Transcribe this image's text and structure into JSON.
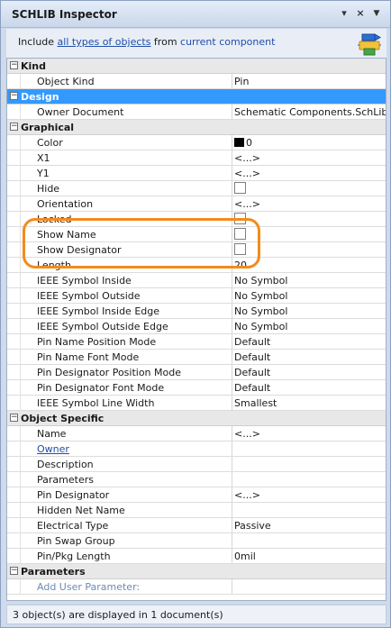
{
  "panel": {
    "title": "SCHLIB Inspector",
    "pin_glyph": "▾",
    "close_glyph": "×",
    "menu_glyph": "▼",
    "filter": {
      "prefix": "Include ",
      "link_all": "all types of objects",
      "middle": " from ",
      "link_scope": "current component"
    }
  },
  "categories": {
    "kind": {
      "label": "Kind",
      "toggle": "−"
    },
    "design": {
      "label": "Design",
      "toggle": "−"
    },
    "graphical": {
      "label": "Graphical",
      "toggle": "−"
    },
    "object_specific": {
      "label": "Object Specific",
      "toggle": "−"
    },
    "parameters": {
      "label": "Parameters",
      "toggle": "−"
    }
  },
  "kind_rows": [
    {
      "label": "Object Kind",
      "value": "Pin"
    }
  ],
  "design_rows": [
    {
      "label": "Owner Document",
      "value": "Schematic Components.SchLib"
    }
  ],
  "graphical": {
    "color": {
      "label": "Color",
      "swatch": "#000000",
      "value": "0"
    },
    "x1": {
      "label": "X1",
      "value": "<...>"
    },
    "y1": {
      "label": "Y1",
      "value": "<...>"
    },
    "hide": {
      "label": "Hide",
      "checked": false
    },
    "orientation": {
      "label": "Orientation",
      "value": "<...>"
    },
    "locked": {
      "label": "Locked",
      "checked": false
    },
    "show_name": {
      "label": "Show Name",
      "checked": false
    },
    "show_designator": {
      "label": "Show Designator",
      "checked": false
    },
    "length": {
      "label": "Length",
      "value": "20"
    },
    "text_rows": [
      {
        "label": "IEEE Symbol Inside",
        "value": "No Symbol"
      },
      {
        "label": "IEEE Symbol Outside",
        "value": "No Symbol"
      },
      {
        "label": "IEEE Symbol Inside Edge",
        "value": "No Symbol"
      },
      {
        "label": "IEEE Symbol Outside Edge",
        "value": "No Symbol"
      },
      {
        "label": "Pin Name Position Mode",
        "value": "Default"
      },
      {
        "label": "Pin Name Font Mode",
        "value": "Default"
      },
      {
        "label": "Pin Designator Position Mode",
        "value": "Default"
      },
      {
        "label": "Pin Designator Font Mode",
        "value": "Default"
      },
      {
        "label": "IEEE Symbol Line Width",
        "value": "Smallest"
      }
    ]
  },
  "object_specific": [
    {
      "label": "Name",
      "value": "<...>"
    },
    {
      "label": "Owner",
      "value": ""
    },
    {
      "label": "Description",
      "value": ""
    },
    {
      "label": "Parameters",
      "value": ""
    },
    {
      "label": "Pin Designator",
      "value": "<...>"
    },
    {
      "label": "Hidden Net Name",
      "value": ""
    },
    {
      "label": "Electrical Type",
      "value": "Passive"
    },
    {
      "label": "Pin Swap Group",
      "value": ""
    },
    {
      "label": "Pin/Pkg Length",
      "value": "0mil"
    }
  ],
  "parameters_rows": [
    {
      "label": "Add User Parameter:",
      "value": ""
    }
  ],
  "status": "3 object(s) are displayed in 1 document(s)",
  "highlight_color": "#f28b1e",
  "selection_color": "#3399ff"
}
